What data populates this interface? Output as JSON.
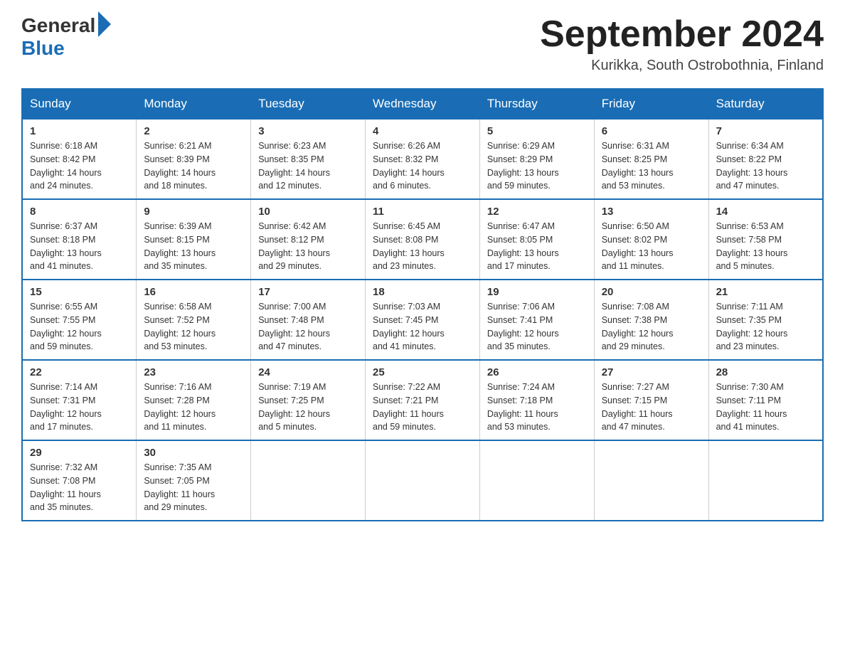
{
  "header": {
    "logo_general": "General",
    "logo_blue": "Blue",
    "month_title": "September 2024",
    "location": "Kurikka, South Ostrobothnia, Finland"
  },
  "weekdays": [
    "Sunday",
    "Monday",
    "Tuesday",
    "Wednesday",
    "Thursday",
    "Friday",
    "Saturday"
  ],
  "weeks": [
    [
      {
        "day": "1",
        "sunrise": "6:18 AM",
        "sunset": "8:42 PM",
        "daylight": "14 hours and 24 minutes."
      },
      {
        "day": "2",
        "sunrise": "6:21 AM",
        "sunset": "8:39 PM",
        "daylight": "14 hours and 18 minutes."
      },
      {
        "day": "3",
        "sunrise": "6:23 AM",
        "sunset": "8:35 PM",
        "daylight": "14 hours and 12 minutes."
      },
      {
        "day": "4",
        "sunrise": "6:26 AM",
        "sunset": "8:32 PM",
        "daylight": "14 hours and 6 minutes."
      },
      {
        "day": "5",
        "sunrise": "6:29 AM",
        "sunset": "8:29 PM",
        "daylight": "13 hours and 59 minutes."
      },
      {
        "day": "6",
        "sunrise": "6:31 AM",
        "sunset": "8:25 PM",
        "daylight": "13 hours and 53 minutes."
      },
      {
        "day": "7",
        "sunrise": "6:34 AM",
        "sunset": "8:22 PM",
        "daylight": "13 hours and 47 minutes."
      }
    ],
    [
      {
        "day": "8",
        "sunrise": "6:37 AM",
        "sunset": "8:18 PM",
        "daylight": "13 hours and 41 minutes."
      },
      {
        "day": "9",
        "sunrise": "6:39 AM",
        "sunset": "8:15 PM",
        "daylight": "13 hours and 35 minutes."
      },
      {
        "day": "10",
        "sunrise": "6:42 AM",
        "sunset": "8:12 PM",
        "daylight": "13 hours and 29 minutes."
      },
      {
        "day": "11",
        "sunrise": "6:45 AM",
        "sunset": "8:08 PM",
        "daylight": "13 hours and 23 minutes."
      },
      {
        "day": "12",
        "sunrise": "6:47 AM",
        "sunset": "8:05 PM",
        "daylight": "13 hours and 17 minutes."
      },
      {
        "day": "13",
        "sunrise": "6:50 AM",
        "sunset": "8:02 PM",
        "daylight": "13 hours and 11 minutes."
      },
      {
        "day": "14",
        "sunrise": "6:53 AM",
        "sunset": "7:58 PM",
        "daylight": "13 hours and 5 minutes."
      }
    ],
    [
      {
        "day": "15",
        "sunrise": "6:55 AM",
        "sunset": "7:55 PM",
        "daylight": "12 hours and 59 minutes."
      },
      {
        "day": "16",
        "sunrise": "6:58 AM",
        "sunset": "7:52 PM",
        "daylight": "12 hours and 53 minutes."
      },
      {
        "day": "17",
        "sunrise": "7:00 AM",
        "sunset": "7:48 PM",
        "daylight": "12 hours and 47 minutes."
      },
      {
        "day": "18",
        "sunrise": "7:03 AM",
        "sunset": "7:45 PM",
        "daylight": "12 hours and 41 minutes."
      },
      {
        "day": "19",
        "sunrise": "7:06 AM",
        "sunset": "7:41 PM",
        "daylight": "12 hours and 35 minutes."
      },
      {
        "day": "20",
        "sunrise": "7:08 AM",
        "sunset": "7:38 PM",
        "daylight": "12 hours and 29 minutes."
      },
      {
        "day": "21",
        "sunrise": "7:11 AM",
        "sunset": "7:35 PM",
        "daylight": "12 hours and 23 minutes."
      }
    ],
    [
      {
        "day": "22",
        "sunrise": "7:14 AM",
        "sunset": "7:31 PM",
        "daylight": "12 hours and 17 minutes."
      },
      {
        "day": "23",
        "sunrise": "7:16 AM",
        "sunset": "7:28 PM",
        "daylight": "12 hours and 11 minutes."
      },
      {
        "day": "24",
        "sunrise": "7:19 AM",
        "sunset": "7:25 PM",
        "daylight": "12 hours and 5 minutes."
      },
      {
        "day": "25",
        "sunrise": "7:22 AM",
        "sunset": "7:21 PM",
        "daylight": "11 hours and 59 minutes."
      },
      {
        "day": "26",
        "sunrise": "7:24 AM",
        "sunset": "7:18 PM",
        "daylight": "11 hours and 53 minutes."
      },
      {
        "day": "27",
        "sunrise": "7:27 AM",
        "sunset": "7:15 PM",
        "daylight": "11 hours and 47 minutes."
      },
      {
        "day": "28",
        "sunrise": "7:30 AM",
        "sunset": "7:11 PM",
        "daylight": "11 hours and 41 minutes."
      }
    ],
    [
      {
        "day": "29",
        "sunrise": "7:32 AM",
        "sunset": "7:08 PM",
        "daylight": "11 hours and 35 minutes."
      },
      {
        "day": "30",
        "sunrise": "7:35 AM",
        "sunset": "7:05 PM",
        "daylight": "11 hours and 29 minutes."
      },
      null,
      null,
      null,
      null,
      null
    ]
  ],
  "labels": {
    "sunrise": "Sunrise:",
    "sunset": "Sunset:",
    "daylight": "Daylight:"
  }
}
